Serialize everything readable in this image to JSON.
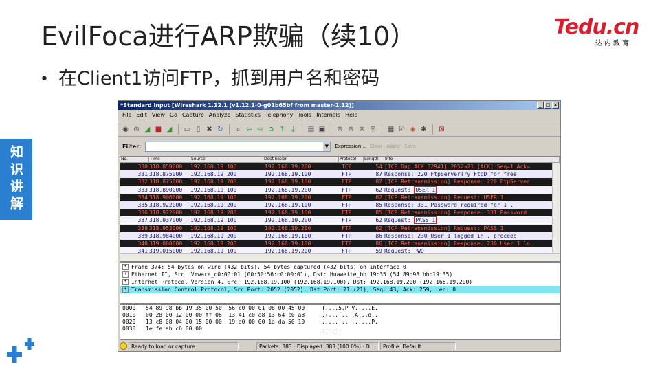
{
  "slide": {
    "title": "EvilFoca进行ARP欺骗（续10）",
    "bullet": "在Client1访问FTP，抓到用户名和密码",
    "side_tab": "知识讲解"
  },
  "logo": {
    "main": "Tedu.cn",
    "sub": "达内教育",
    "color": "#d81e2c"
  },
  "wireshark": {
    "title": "*Standard input   [Wireshark 1.12.1  (v1.12.1-0-g01b65bf from master-1.12)]",
    "window_buttons": [
      "_",
      "□",
      "×"
    ],
    "menu": [
      "File",
      "Edit",
      "View",
      "Go",
      "Capture",
      "Analyze",
      "Statistics",
      "Telephony",
      "Tools",
      "Internals",
      "Help"
    ],
    "filter": {
      "label": "Filter:",
      "value": "",
      "buttons": [
        "Expression...",
        "Clear",
        "Apply",
        "Save"
      ]
    },
    "columns": [
      "No.",
      "Time",
      "Source",
      "Destination",
      "Protocol",
      "Length",
      "Info"
    ],
    "packets": [
      {
        "no": "330",
        "time": "318.859000",
        "src": "192.168.19.100",
        "dst": "192.168.19.200",
        "proto": "TCP",
        "len": "54",
        "info": "[TCP Dup ACK 329#1] 2052→21 [ACK] Seq=1 Ack=",
        "style": "retx"
      },
      {
        "no": "331",
        "time": "318.875000",
        "src": "192.168.19.200",
        "dst": "192.168.19.100",
        "proto": "FTP",
        "len": "87",
        "info": "Response: 220 FtpServerTry FtpD for free",
        "style": "ftp"
      },
      {
        "no": "332",
        "time": "318.875000",
        "src": "192.168.19.200",
        "dst": "192.168.19.100",
        "proto": "FTP",
        "len": "87",
        "info": "[TCP Retransmission] Response: 220 FtpServer",
        "style": "retx"
      },
      {
        "no": "333",
        "time": "318.890000",
        "src": "192.168.19.100",
        "dst": "192.168.19.200",
        "proto": "FTP",
        "len": "62",
        "info_prefix": "Request: ",
        "info_boxed": "USER 1",
        "style": "alt"
      },
      {
        "no": "334",
        "time": "318.906000",
        "src": "192.168.19.100",
        "dst": "192.168.19.200",
        "proto": "FTP",
        "len": "62",
        "info": "[TCP Retransmission] Request: USER 1",
        "style": "retx"
      },
      {
        "no": "335",
        "time": "318.922000",
        "src": "192.168.19.200",
        "dst": "192.168.19.100",
        "proto": "FTP",
        "len": "85",
        "info": "Response: 331 Password required for 1 .",
        "style": "ftp"
      },
      {
        "no": "336",
        "time": "318.922000",
        "src": "192.168.19.200",
        "dst": "192.168.19.100",
        "proto": "FTP",
        "len": "85",
        "info": "[TCP Retransmission] Response: 331 Password",
        "style": "retx"
      },
      {
        "no": "337",
        "time": "318.937000",
        "src": "192.168.19.100",
        "dst": "192.168.19.200",
        "proto": "FTP",
        "len": "62",
        "info_prefix": "Request: ",
        "info_boxed": "PASS 1",
        "style": "alt"
      },
      {
        "no": "338",
        "time": "318.953000",
        "src": "192.168.19.100",
        "dst": "192.168.19.200",
        "proto": "FTP",
        "len": "62",
        "info": "[TCP Retransmission] Request: PASS 1",
        "style": "retx"
      },
      {
        "no": "339",
        "time": "318.984000",
        "src": "192.168.19.200",
        "dst": "192.168.19.100",
        "proto": "FTP",
        "len": "86",
        "info": "Response: 230 User 1 logged in , proceed",
        "style": "ftp"
      },
      {
        "no": "340",
        "time": "319.000000",
        "src": "192.168.19.200",
        "dst": "192.168.19.100",
        "proto": "FTP",
        "len": "86",
        "info": "[TCP Retransmission] Response: 230 User 1 lo",
        "style": "retx"
      },
      {
        "no": "341",
        "time": "319.015000",
        "src": "192.168.19.100",
        "dst": "192.168.19.200",
        "proto": "FTP",
        "len": "59",
        "info": "Request: PWD",
        "style": "alt"
      }
    ],
    "details": [
      {
        "text": "Frame 374: 54 bytes on wire (432 bits), 54 bytes captured (432 bits) on interface 0",
        "selected": false
      },
      {
        "text": "Ethernet II, Src: Vmware_c0:00:01 (00:50:56:c0:00:01), Dst: Huaweite_bb:19:35 (54:89:98:bb:19:35)",
        "selected": false
      },
      {
        "text": "Internet Protocol Version 4, Src: 192.168.19.100 (192.168.19.100), Dst: 192.168.19.200 (192.168.19.200)",
        "selected": false
      },
      {
        "text": "Transmission Control Protocol, Src Port: 2052 (2052), Dst Port: 21 (21), Seq: 43, Ack: 259, Len: 0",
        "selected": true
      }
    ],
    "bytes": [
      {
        "off": "0000",
        "hex": "54 89 98 bb 19 35 00 50  56 c0 00 01 08 00 45 00",
        "ascii": "T....5.P V.....E."
      },
      {
        "off": "0010",
        "hex": "00 28 00 12 00 00 ff 06  13 41 c0 a8 13 64 c0 a8",
        "ascii": ".(...... .A...d.."
      },
      {
        "off": "0020",
        "hex": "13 c8 08 04 00 15 00 00  19 a0 00 00 1a da 50 10",
        "ascii": "........ ......P."
      },
      {
        "off": "0030",
        "hex": "1e fe ab c6 00 00",
        "ascii": "......"
      }
    ],
    "status": {
      "ready": "Ready to load or capture",
      "packets": "Packets: 383 · Displayed: 383 (100.0%) · D...",
      "profile": "Profile: Default"
    }
  }
}
